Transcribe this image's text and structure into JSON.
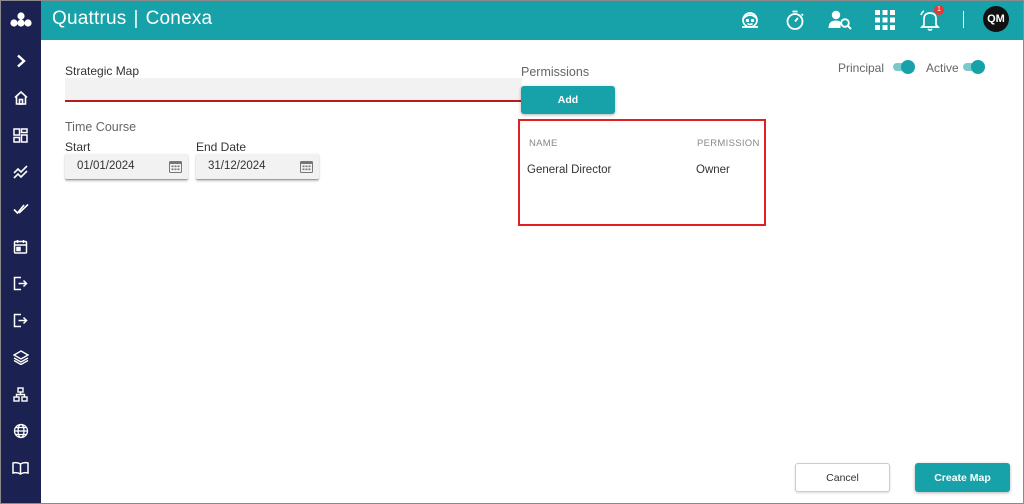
{
  "header": {
    "brand_name": "Quattrus",
    "brand_separator": "|",
    "brand_product": "Conexa",
    "icons": [
      "support-agent-icon",
      "stopwatch-icon",
      "user-search-icon",
      "apps-grid-icon",
      "notification-bell-icon"
    ],
    "notification_count": "1",
    "avatar_initials": "QM"
  },
  "sidebar": {
    "items": [
      "expand-chevron-icon",
      "home-icon",
      "dashboard-icon",
      "trend-icon",
      "check-all-icon",
      "calendar-icon",
      "import-icon",
      "export-icon",
      "layers-icon",
      "hierarchy-icon",
      "globe-icon",
      "book-icon"
    ]
  },
  "form": {
    "strategic_map_label": "Strategic Map",
    "strategic_map_value": "",
    "time_course_label": "Time Course",
    "start_label": "Start",
    "start_value": "01/01/2024",
    "end_label": "End Date",
    "end_value": "31/12/2024"
  },
  "permissions": {
    "label": "Permissions",
    "add_button": "Add",
    "columns": [
      "NAME",
      "PERMISSION"
    ],
    "rows": [
      {
        "name": "General Director",
        "permission": "Owner"
      }
    ]
  },
  "toggles": {
    "principal_label": "Principal",
    "principal_on": true,
    "active_label": "Active",
    "active_on": true
  },
  "footer": {
    "cancel_button": "Cancel",
    "create_button": "Create Map"
  },
  "colors": {
    "primary": "#16a2a8",
    "sidebar": "#1b2150",
    "input_underline": "#b71c1c",
    "highlight_border": "#e02020"
  }
}
